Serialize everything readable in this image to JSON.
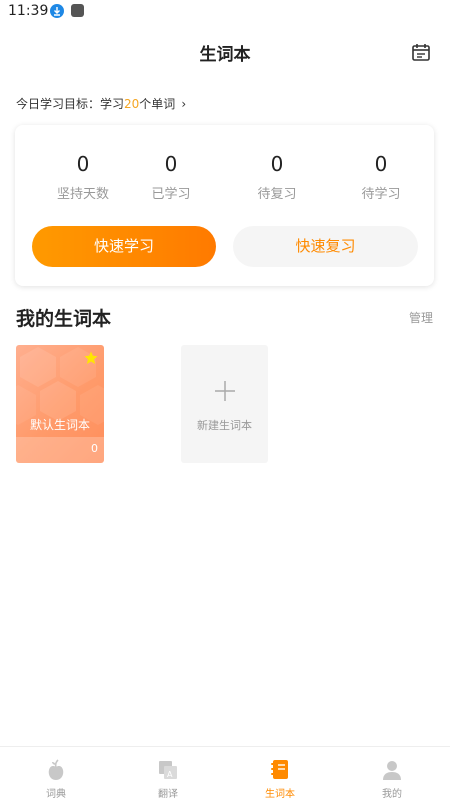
{
  "status_bar": {
    "time": "11:39"
  },
  "header": {
    "title": "生词本"
  },
  "goal": {
    "prefix": "今日学习目标：学习",
    "count": "20",
    "suffix": "个单词",
    "chevron": "›"
  },
  "stats": [
    {
      "value": "0",
      "label": "坚持天数"
    },
    {
      "value": "0",
      "label": "已学习"
    },
    {
      "value": "0",
      "label": "待复习"
    },
    {
      "value": "0",
      "label": "待学习"
    }
  ],
  "actions": {
    "quick_learn": "快速学习",
    "quick_review": "快速复习"
  },
  "section": {
    "title": "我的生词本",
    "manage": "管理"
  },
  "notebooks": [
    {
      "name": "默认生词本",
      "count": "0",
      "starred": true
    }
  ],
  "new_notebook": {
    "label": "新建生词本"
  },
  "bottom_nav": [
    {
      "label": "词典",
      "icon": "dictionary-icon",
      "active": false
    },
    {
      "label": "翻译",
      "icon": "translate-icon",
      "active": false
    },
    {
      "label": "生词本",
      "icon": "notebook-icon",
      "active": true
    },
    {
      "label": "我的",
      "icon": "profile-icon",
      "active": false
    }
  ],
  "colors": {
    "accent": "#FF8A00",
    "accent_light": "#FFA94D",
    "goal_number": "#F5A623"
  }
}
